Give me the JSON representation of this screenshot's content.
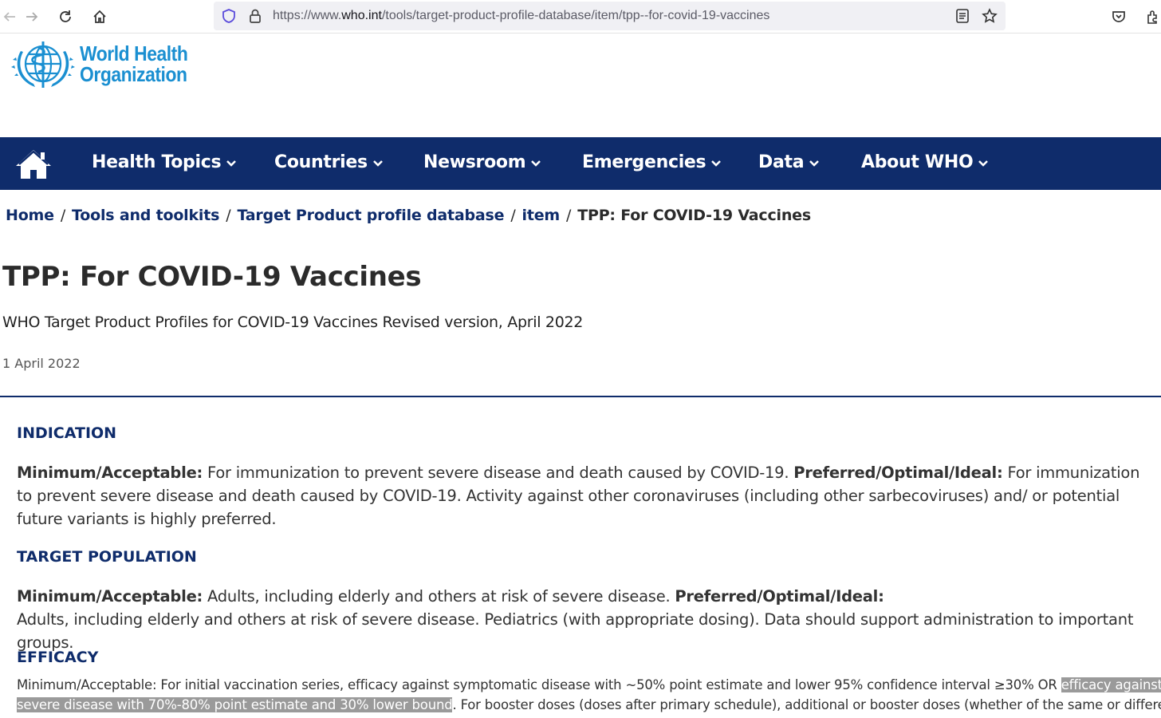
{
  "browser": {
    "url_prefix": "https://www.",
    "url_domain": "who.int",
    "url_path": "/tools/target-product-profile-database/item/tpp--for-covid-19-vaccines"
  },
  "logo": {
    "line1": "World Health",
    "line2": "Organization"
  },
  "nav": {
    "items": [
      "Health Topics",
      "Countries",
      "Newsroom",
      "Emergencies",
      "Data",
      "About WHO"
    ]
  },
  "breadcrumb": {
    "items": [
      "Home",
      "Tools and toolkits",
      "Target Product profile database",
      "item"
    ],
    "current": "TPP: For COVID-19 Vaccines",
    "separator": "/"
  },
  "page": {
    "title": "TPP: For COVID-19 Vaccines",
    "subtitle": "WHO Target Product Profiles for COVID-19 Vaccines Revised version, April 2022",
    "date": "1 April 2022"
  },
  "sections": {
    "indication": {
      "heading": "INDICATION",
      "min_label": "Minimum/Acceptable:",
      "min_text": " For immunization to prevent severe disease and death caused by COVID-19.  ",
      "pref_label": "Preferred/Optimal/Ideal:",
      "pref_text": " For immunization to prevent severe disease and death caused by COVID-19. Activity against other coronaviruses (including other sarbecoviruses) and/ or potential future variants is highly preferred."
    },
    "target_population": {
      "heading": "TARGET POPULATION",
      "min_label": "Minimum/Acceptable:",
      "min_text": " Adults, including elderly and others at risk of severe disease. ",
      "pref_label": "Preferred/Optimal/Ideal:",
      "pref_text": "Adults, including elderly and others at risk of severe disease. Pediatrics (with appropriate dosing). Data should support administration to important groups."
    },
    "efficacy": {
      "heading": "EFFICACY",
      "line1_text": "Minimum/Acceptable: For initial vaccination series, efficacy against symptomatic disease with ~50% point estimate and lower 95% confidence interval ≥30% OR ",
      "line1_highlight": "efficacy against",
      "line2_highlight": "severe disease with 70%-80% point estimate and 30% lower bound",
      "line2_text": ". For booster doses (doses after primary schedule), additional or booster doses (whether of the same or different"
    }
  },
  "colors": {
    "brand_navy": "#0f2c6b",
    "logo_blue": "#1a8fd1",
    "highlight": "#9a9a9a"
  }
}
